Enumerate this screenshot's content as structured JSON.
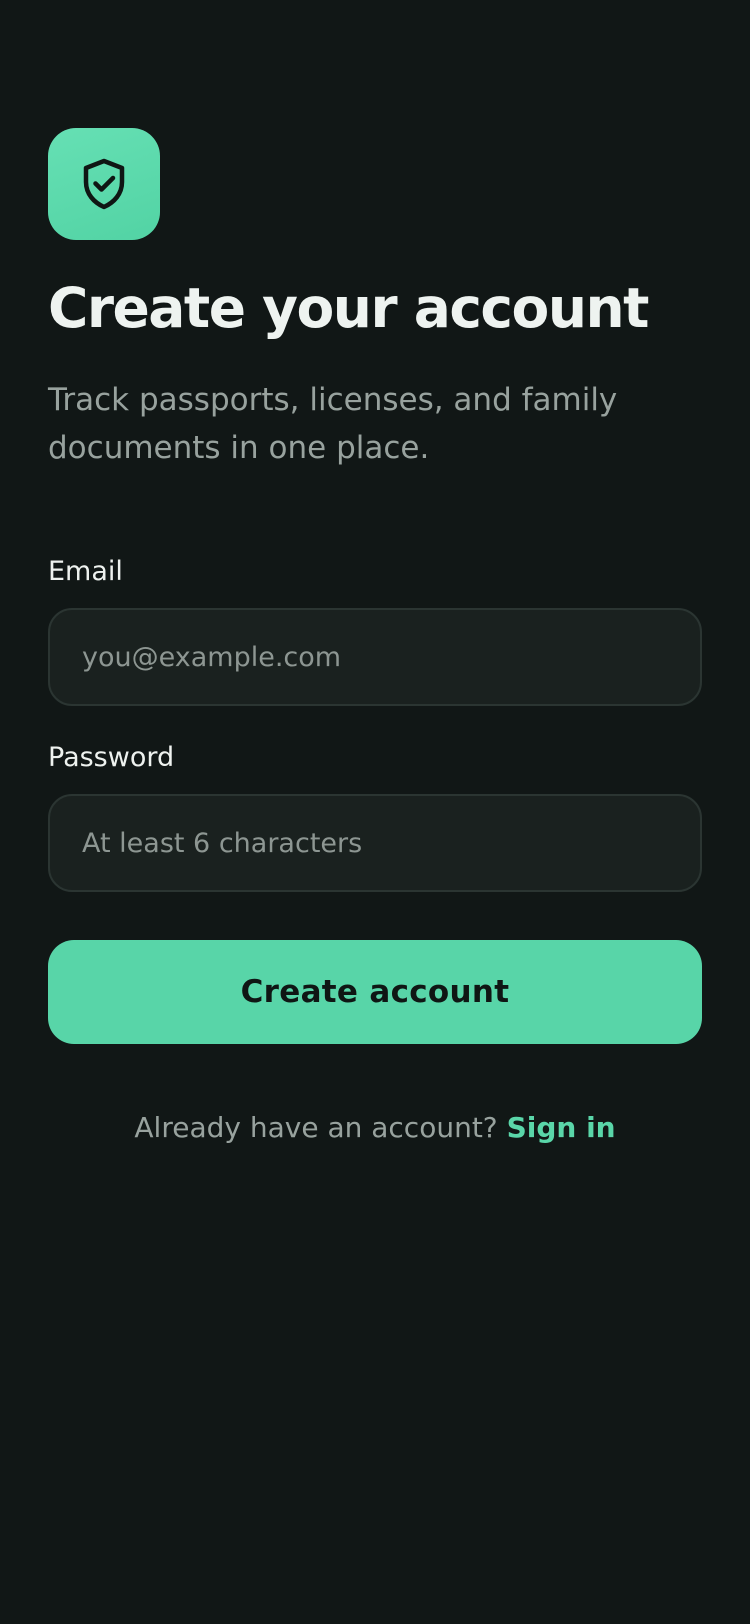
{
  "app": {
    "logo_icon": "shield-check-icon",
    "accent_color": "#58d5a8",
    "background_color": "#111716"
  },
  "header": {
    "title": "Create your account",
    "subtitle": "Track passports, licenses, and family documents in one place."
  },
  "form": {
    "email": {
      "label": "Email",
      "value": "",
      "placeholder": "you@example.com"
    },
    "password": {
      "label": "Password",
      "value": "",
      "placeholder": "At least 6 characters"
    },
    "submit_label": "Create account"
  },
  "footer": {
    "prompt": "Already have an account? ",
    "link_label": "Sign in"
  }
}
